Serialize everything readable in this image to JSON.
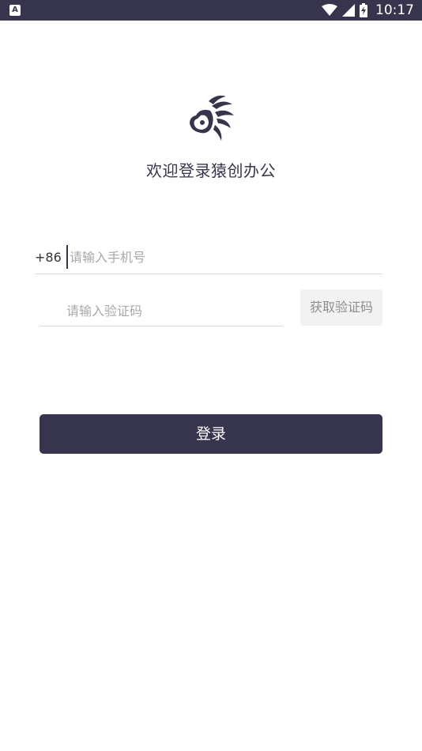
{
  "status_bar": {
    "left_icon_letter": "A",
    "time": "10:17",
    "icons": [
      "notification-a-icon",
      "wifi-icon",
      "signal-icon",
      "battery-charging-icon"
    ]
  },
  "header": {
    "logo_icon": "monkey-logo-icon",
    "welcome_text": "欢迎登录猿创办公"
  },
  "phone": {
    "country_code": "+86",
    "placeholder": "请输入手机号",
    "value": ""
  },
  "verification": {
    "placeholder": "请输入验证码",
    "value": "",
    "get_code_label": "获取验证码"
  },
  "login": {
    "label": "登录"
  },
  "colors": {
    "primary": "#37354d",
    "placeholder": "#a8a8a8",
    "divider": "#dcdcdc",
    "secondary_button_bg": "#f2f2f2"
  }
}
